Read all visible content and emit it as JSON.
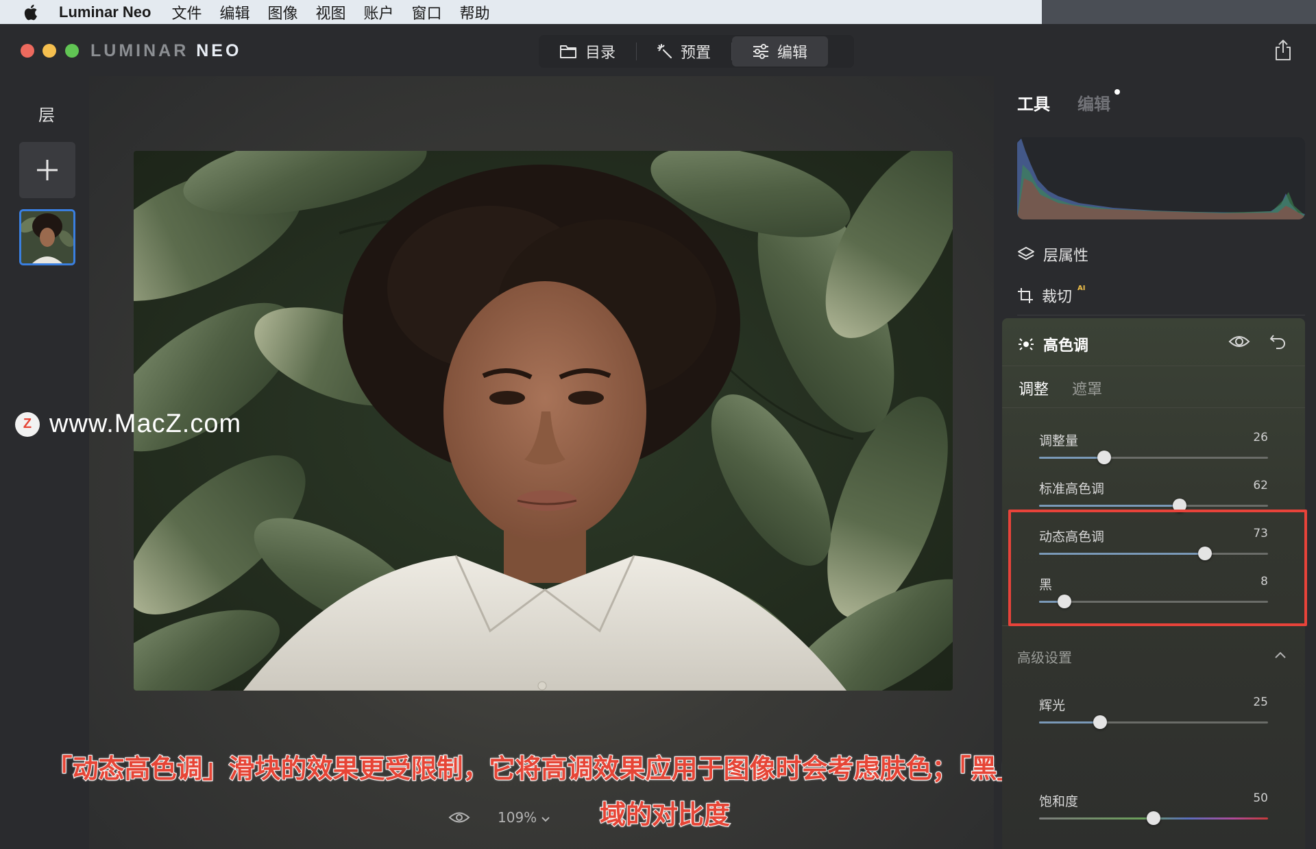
{
  "menubar": {
    "app_name": "Luminar Neo",
    "items": [
      "文件",
      "编辑",
      "图像",
      "视图",
      "账户",
      "窗口",
      "帮助"
    ]
  },
  "titlebar": {
    "logo_main": "LUMINAR",
    "logo_neo": "NEO",
    "tabs": [
      {
        "label": "目录",
        "icon": "folder-icon"
      },
      {
        "label": "预置",
        "icon": "magic-wand-icon"
      },
      {
        "label": "编辑",
        "icon": "sliders-icon",
        "active": true
      }
    ]
  },
  "layers": {
    "title": "层"
  },
  "watermark": {
    "text": "www.MacZ.com",
    "logo_letter": "Z"
  },
  "zoom": {
    "value": "109%"
  },
  "caption": {
    "line1": "「动态高色调」滑块的效果更受限制，它将高调效果应用于图像时会考虑肤色；「黑」滑块可保持图像最暗区",
    "line2": "域的对比度"
  },
  "right_panel": {
    "tabs": [
      "工具",
      "编辑"
    ],
    "tools": [
      {
        "label": "层属性",
        "icon": "layers-icon"
      },
      {
        "label": "裁切",
        "icon": "crop-icon",
        "badge": "AI"
      }
    ],
    "tool_panel": {
      "title": "高色调",
      "sub_tabs": [
        "调整",
        "遮罩"
      ],
      "sliders": [
        {
          "label": "调整量",
          "value": "26",
          "pct": 0.285
        },
        {
          "label": "标准高色调",
          "value": "62",
          "pct": 0.615
        },
        {
          "label": "动态高色调",
          "value": "73",
          "pct": 0.725
        },
        {
          "label": "黑",
          "value": "8",
          "pct": 0.11
        }
      ],
      "advanced": {
        "title": "高级设置",
        "sliders": [
          {
            "label": "辉光",
            "value": "25",
            "pct": 0.265
          },
          {
            "label": "饱和度",
            "value": "50",
            "pct": 0.5
          }
        ]
      }
    }
  },
  "colors": {
    "accent_blue": "#3a7fe0",
    "highlight_red": "#e8433a",
    "caption_red": "#e64536"
  }
}
